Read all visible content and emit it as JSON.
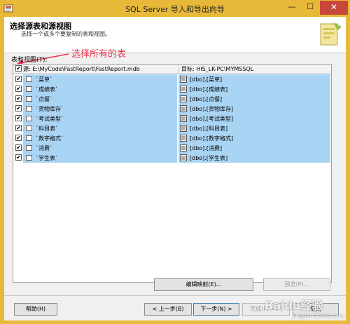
{
  "window": {
    "title": "SQL Server 导入和导出向导",
    "min_glyph": "—",
    "max_glyph": "☐",
    "close_glyph": "✕"
  },
  "header": {
    "title": "选择源表和源视图",
    "subtitle": "选择一个或多个要复制的表和视图。"
  },
  "annotation": {
    "text": "选择所有的表",
    "color": "#e8364a"
  },
  "tables_label": "表和视图(T):",
  "grid": {
    "source_header": "源: E:\\MyCode\\FastReport\\FastReport.mdb",
    "destination_header": "目标: HIS_LK-PC\\MYMSSQL",
    "header_checked": true,
    "rows": [
      {
        "source": "`菜单`",
        "destination": "[dbo].[菜单]",
        "checked": true
      },
      {
        "source": "`成绩表`",
        "destination": "[dbo].[成绩表]",
        "checked": true
      },
      {
        "source": "`点餐`",
        "destination": "[dbo].[点餐]",
        "checked": true
      },
      {
        "source": "`货物库存`",
        "destination": "[dbo].[货物库存]",
        "checked": true
      },
      {
        "source": "`考试类型`",
        "destination": "[dbo].[考试类型]",
        "checked": true
      },
      {
        "source": "`科目表`",
        "destination": "[dbo].[科目表]",
        "checked": true
      },
      {
        "source": "`数字格式`",
        "destination": "[dbo].[数字格式]",
        "checked": true
      },
      {
        "source": "`消费`",
        "destination": "[dbo].[消费]",
        "checked": true
      },
      {
        "source": "`学生表`",
        "destination": "[dbo].[学生表]",
        "checked": true
      }
    ],
    "selected_color": "#aad4f4"
  },
  "buttons": {
    "edit_mappings": "编辑映射(E)...",
    "preview": "预览(P)...",
    "help": "帮助(H)",
    "back": "< 上一步(B)",
    "next": "下一步(N) >",
    "finish": "完成(F) >>|",
    "cancel": "取消"
  },
  "watermark": {
    "brand": "Baidu经验",
    "url": "jingyan.baidu.com"
  },
  "colors": {
    "frame": "#e8b938",
    "close_button": "#c7483a"
  }
}
